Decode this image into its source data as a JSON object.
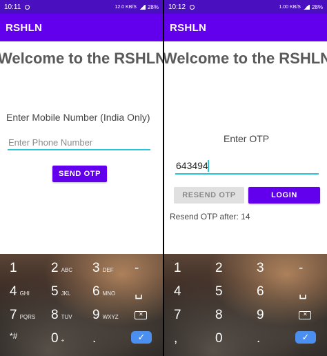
{
  "left": {
    "status": {
      "time": "10:11",
      "net": "12.0 KB/S",
      "pct": "28%"
    },
    "appbar_title": "RSHLN",
    "welcome": "Welcome to the RSHLN",
    "mobile_label": "Enter Mobile Number (India Only)",
    "phone_placeholder": "Enter Phone Number",
    "send_otp_label": "SEND OTP"
  },
  "right": {
    "status": {
      "time": "10:12",
      "net": "1.00 KB/S",
      "pct": "28%"
    },
    "appbar_title": "RSHLN",
    "welcome": "Welcome to the RSHLN",
    "otp_label": "Enter OTP",
    "otp_value": "643494",
    "resend_label": "RESEND OTP",
    "login_label": "LOGIN",
    "resend_timer": "Resend OTP after: 14"
  },
  "keyboard": {
    "rows": [
      [
        {
          "n": "1",
          "s": ""
        },
        {
          "n": "2",
          "s": "ABC"
        },
        {
          "n": "3",
          "s": "DEF"
        },
        {
          "n": "-",
          "s": ""
        }
      ],
      [
        {
          "n": "4",
          "s": "GHI"
        },
        {
          "n": "5",
          "s": "JKL"
        },
        {
          "n": "6",
          "s": "MNO"
        },
        {
          "n": "␣",
          "s": ""
        }
      ],
      [
        {
          "n": "7",
          "s": "PQRS"
        },
        {
          "n": "8",
          "s": "TUV"
        },
        {
          "n": "9",
          "s": "WXYZ"
        },
        {
          "n": "⌫",
          "s": ""
        }
      ],
      [
        {
          "n": "*#",
          "s": ""
        },
        {
          "n": "0",
          "s": "+"
        },
        {
          "n": ".",
          "s": ""
        },
        {
          "n": "✓",
          "s": ""
        }
      ]
    ]
  },
  "colors": {
    "primary": "#6200ee",
    "statusbar": "#4a0fbf",
    "accent": "#26c6da",
    "enter": "#4b8ff0"
  }
}
